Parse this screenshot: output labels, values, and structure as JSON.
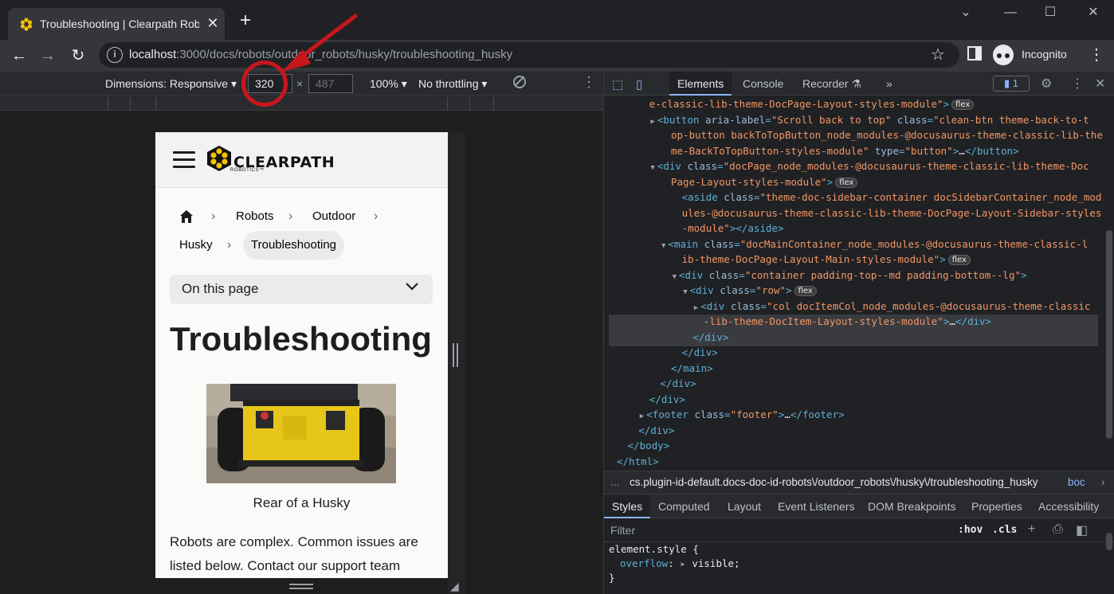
{
  "browser": {
    "tab_title": "Troubleshooting | Clearpath Robo",
    "tab_close": "✕",
    "new_tab": "+",
    "window_controls": {
      "tabsearch": "⌄",
      "minimize": "—",
      "maximize": "☐",
      "close": "✕"
    },
    "nav": {
      "back": "←",
      "forward": "→",
      "reload": "↻"
    },
    "url_host": "localhost",
    "url_rest": ":3000/docs/robots/outdoor_robots/husky/troubleshooting_husky",
    "bookmark_star": "☆",
    "profile_label": "Incognito",
    "menu": "⋮"
  },
  "device_toolbar": {
    "dimensions_label": "Dimensions: Responsive ▾",
    "width_value": "320",
    "height_placeholder": "487",
    "times": "×",
    "zoom": "100% ▾",
    "throttling": "No throttling ▾",
    "more": "⋮"
  },
  "page": {
    "logo_word": "CLEARPATH",
    "logo_sub": "ROBOTICS™",
    "breadcrumbs": [
      "Robots",
      "Outdoor",
      "Husky"
    ],
    "breadcrumb_sep": "›",
    "breadcrumb_active": "Troubleshooting",
    "toc_label": "On this page",
    "heading": "Troubleshooting",
    "image_caption": "Rear of a Husky",
    "body_text": "Robots are complex. Common issues are listed below. Contact our support team"
  },
  "devtools": {
    "tabs": [
      "Elements",
      "Console",
      "Recorder ⚗",
      "»"
    ],
    "active_tab": "Elements",
    "issues_badge": "1",
    "issues_icon": "▮",
    "settings": "⚙",
    "more": "⋮",
    "close": "✕",
    "dom_lines": [
      {
        "indent": 3,
        "tri": "",
        "parts": [
          [
            "val",
            "e-classic-lib-theme-DocPage-Layout-styles-module\""
          ],
          [
            "tag",
            ">"
          ]
        ],
        "badge": "flex"
      },
      {
        "indent": 4,
        "tri": "▶",
        "parts": [
          [
            "tag",
            "<button "
          ],
          [
            "attr",
            "aria-label"
          ],
          [
            "tag",
            "="
          ],
          [
            "val",
            "\"Scroll back to top\""
          ],
          [
            "attr",
            " class"
          ],
          [
            "tag",
            "="
          ],
          [
            "val",
            "\"clean-btn theme-back-to-t"
          ]
        ],
        "badge": ""
      },
      {
        "indent": 5,
        "tri": "",
        "parts": [
          [
            "val",
            "op-button backToTopButton_node_modules-@docusaurus-theme-classic-lib-the"
          ]
        ],
        "badge": ""
      },
      {
        "indent": 5,
        "tri": "",
        "parts": [
          [
            "val",
            "me-BackToTopButton-styles-module\""
          ],
          [
            "attr",
            " type"
          ],
          [
            "tag",
            "="
          ],
          [
            "val",
            "\"button\""
          ],
          [
            "tag",
            ">"
          ],
          [
            "txt",
            "…"
          ],
          [
            "tag",
            "</button>"
          ]
        ],
        "badge": ""
      },
      {
        "indent": 4,
        "tri": "▼",
        "parts": [
          [
            "tag",
            "<div "
          ],
          [
            "attr",
            "class"
          ],
          [
            "tag",
            "="
          ],
          [
            "val",
            "\"docPage_node_modules-@docusaurus-theme-classic-lib-theme-Doc"
          ]
        ],
        "badge": ""
      },
      {
        "indent": 5,
        "tri": "",
        "parts": [
          [
            "val",
            "Page-Layout-styles-module\""
          ],
          [
            "tag",
            ">"
          ]
        ],
        "badge": "flex"
      },
      {
        "indent": 6,
        "tri": "",
        "parts": [
          [
            "tag",
            "<aside "
          ],
          [
            "attr",
            "class"
          ],
          [
            "tag",
            "="
          ],
          [
            "val",
            "\"theme-doc-sidebar-container docSidebarContainer_node_mod"
          ]
        ],
        "badge": ""
      },
      {
        "indent": 6,
        "tri": "",
        "parts": [
          [
            "val",
            "ules-@docusaurus-theme-classic-lib-theme-DocPage-Layout-Sidebar-styles"
          ]
        ],
        "badge": ""
      },
      {
        "indent": 6,
        "tri": "",
        "parts": [
          [
            "val",
            "-module\""
          ],
          [
            "tag",
            "></aside>"
          ]
        ],
        "badge": ""
      },
      {
        "indent": 5,
        "tri": "▼",
        "parts": [
          [
            "tag",
            "<main "
          ],
          [
            "attr",
            "class"
          ],
          [
            "tag",
            "="
          ],
          [
            "val",
            "\"docMainContainer_node_modules-@docusaurus-theme-classic-l"
          ]
        ],
        "badge": ""
      },
      {
        "indent": 6,
        "tri": "",
        "parts": [
          [
            "val",
            "ib-theme-DocPage-Layout-Main-styles-module\""
          ],
          [
            "tag",
            ">"
          ]
        ],
        "badge": "flex"
      },
      {
        "indent": 6,
        "tri": "▼",
        "parts": [
          [
            "tag",
            "<div "
          ],
          [
            "attr",
            "class"
          ],
          [
            "tag",
            "="
          ],
          [
            "val",
            "\"container padding-top--md padding-bottom--lg\""
          ],
          [
            "tag",
            ">"
          ]
        ],
        "badge": ""
      },
      {
        "indent": 7,
        "tri": "▼",
        "parts": [
          [
            "tag",
            "<div "
          ],
          [
            "attr",
            "class"
          ],
          [
            "tag",
            "="
          ],
          [
            "val",
            "\"row\""
          ],
          [
            "tag",
            ">"
          ]
        ],
        "badge": "flex"
      },
      {
        "indent": 8,
        "tri": "▶",
        "parts": [
          [
            "tag",
            "<div "
          ],
          [
            "attr",
            "class"
          ],
          [
            "tag",
            "="
          ],
          [
            "val",
            "\"col docItemCol_node_modules-@docusaurus-theme-classic"
          ]
        ],
        "badge": ""
      },
      {
        "indent": 8,
        "tri": "",
        "parts": [
          [
            "val",
            "-lib-theme-DocItem-Layout-styles-module\""
          ],
          [
            "tag",
            ">"
          ],
          [
            "txt",
            "…"
          ],
          [
            "tag",
            "</div>"
          ]
        ],
        "badge": ""
      },
      {
        "indent": 7,
        "tri": "",
        "parts": [
          [
            "tag",
            "</div>"
          ]
        ],
        "badge": ""
      },
      {
        "indent": 6,
        "tri": "",
        "parts": [
          [
            "tag",
            "</div>"
          ]
        ],
        "badge": ""
      },
      {
        "indent": 5,
        "tri": "",
        "parts": [
          [
            "tag",
            "</main>"
          ]
        ],
        "badge": ""
      },
      {
        "indent": 4,
        "tri": "",
        "parts": [
          [
            "tag",
            "</div>"
          ]
        ],
        "badge": ""
      },
      {
        "indent": 3,
        "tri": "",
        "parts": [
          [
            "tag",
            "</div>"
          ]
        ],
        "badge": ""
      },
      {
        "indent": 3,
        "tri": "▶",
        "parts": [
          [
            "tag",
            "<footer "
          ],
          [
            "attr",
            "class"
          ],
          [
            "tag",
            "="
          ],
          [
            "val",
            "\"footer\""
          ],
          [
            "tag",
            ">"
          ],
          [
            "txt",
            "…"
          ],
          [
            "tag",
            "</footer>"
          ]
        ],
        "badge": ""
      },
      {
        "indent": 2,
        "tri": "",
        "parts": [
          [
            "tag",
            "</div>"
          ]
        ],
        "badge": ""
      },
      {
        "indent": 1,
        "tri": "",
        "parts": [
          [
            "tag",
            "</body>"
          ]
        ],
        "badge": ""
      },
      {
        "indent": 0,
        "tri": "",
        "parts": [
          [
            "tag",
            "</html>"
          ]
        ],
        "badge": ""
      }
    ],
    "breadcrumb_ellipsis": "...",
    "breadcrumb_path": "cs.plugin-id-default.docs-doc-id-robots\\/outdoor_robots\\/husky\\/troubleshooting_husky",
    "breadcrumb_next": "boc",
    "breadcrumb_arrow": "›",
    "styles_tabs": [
      "Styles",
      "Computed",
      "Layout",
      "Event Listeners",
      "DOM Breakpoints",
      "Properties",
      "Accessibility"
    ],
    "active_styles_tab": "Styles",
    "filter_placeholder": "Filter",
    "hov": ":hov",
    "cls": ".cls",
    "style_selector": "element.style {",
    "style_prop": "overflow",
    "style_value": "visible;",
    "style_close": "}"
  }
}
